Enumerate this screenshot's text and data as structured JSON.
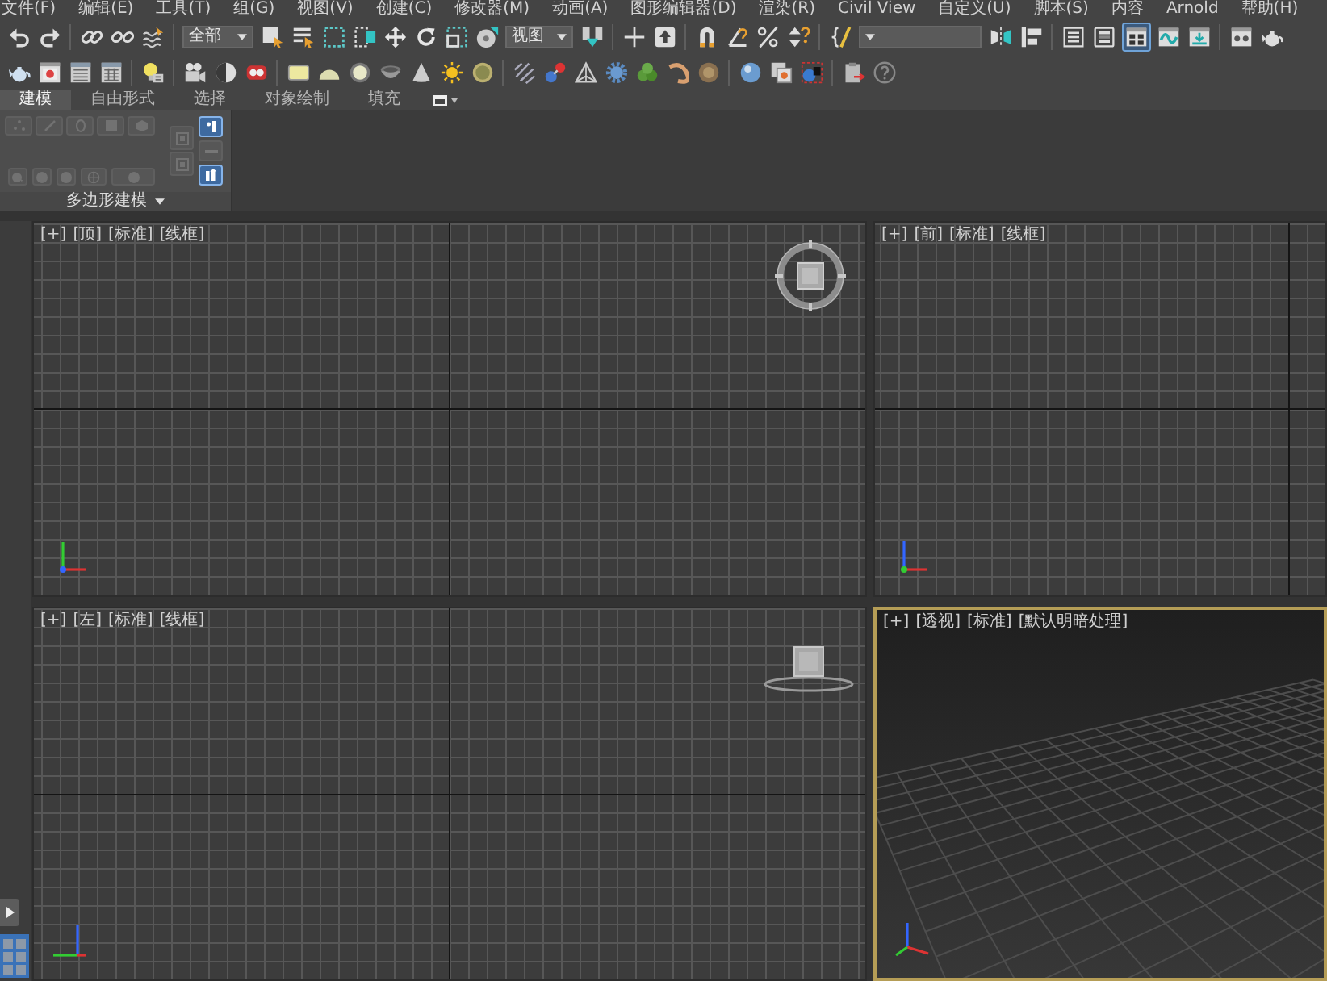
{
  "menu_bar": [
    "文件(F)",
    "编辑(E)",
    "工具(T)",
    "组(G)",
    "视图(V)",
    "创建(C)",
    "修改器(M)",
    "动画(A)",
    "图形编辑器(D)",
    "渲染(R)",
    "Civil View",
    "自定义(U)",
    "脚本(S)",
    "内容",
    "Arnold",
    "帮助(H)"
  ],
  "main_toolbar": {
    "selection_filter": "全部",
    "coordinate_system": "视图",
    "ribbon_toggle": {
      "on": true
    }
  },
  "ribbon": {
    "tabs": [
      {
        "label": "建模",
        "selected": true
      },
      {
        "label": "自由形式",
        "selected": false
      },
      {
        "label": "选择",
        "selected": false
      },
      {
        "label": "对象绘制",
        "selected": false
      },
      {
        "label": "填充",
        "selected": false
      }
    ],
    "panel": {
      "title": "多边形建模",
      "buttons": [
        {
          "disabled": true
        },
        {
          "disabled": true
        },
        {
          "disabled": true
        },
        {
          "disabled": true
        },
        {
          "disabled": true
        },
        {
          "disabled": true
        },
        {
          "disabled": true
        },
        {
          "disabled": true
        },
        {
          "disabled": true
        },
        {
          "disabled": true
        },
        {
          "disabled": true
        },
        {
          "disabled": true
        }
      ],
      "toggles": [
        {
          "on": true
        },
        {
          "on": false
        },
        {
          "on": true
        }
      ]
    }
  },
  "viewports": [
    {
      "kind": "top",
      "active": false,
      "labels": [
        "[+]",
        "[顶]",
        "[标准]",
        "[线框]"
      ]
    },
    {
      "kind": "front",
      "active": false,
      "labels": [
        "[+]",
        "[前]",
        "[标准]",
        "[线框]"
      ]
    },
    {
      "kind": "left",
      "active": false,
      "labels": [
        "[+]",
        "[左]",
        "[标准]",
        "[线框]"
      ]
    },
    {
      "kind": "perspective",
      "active": true,
      "labels": [
        "[+]",
        "[透视]",
        "[标准]",
        "[默认明暗处理]"
      ]
    }
  ]
}
